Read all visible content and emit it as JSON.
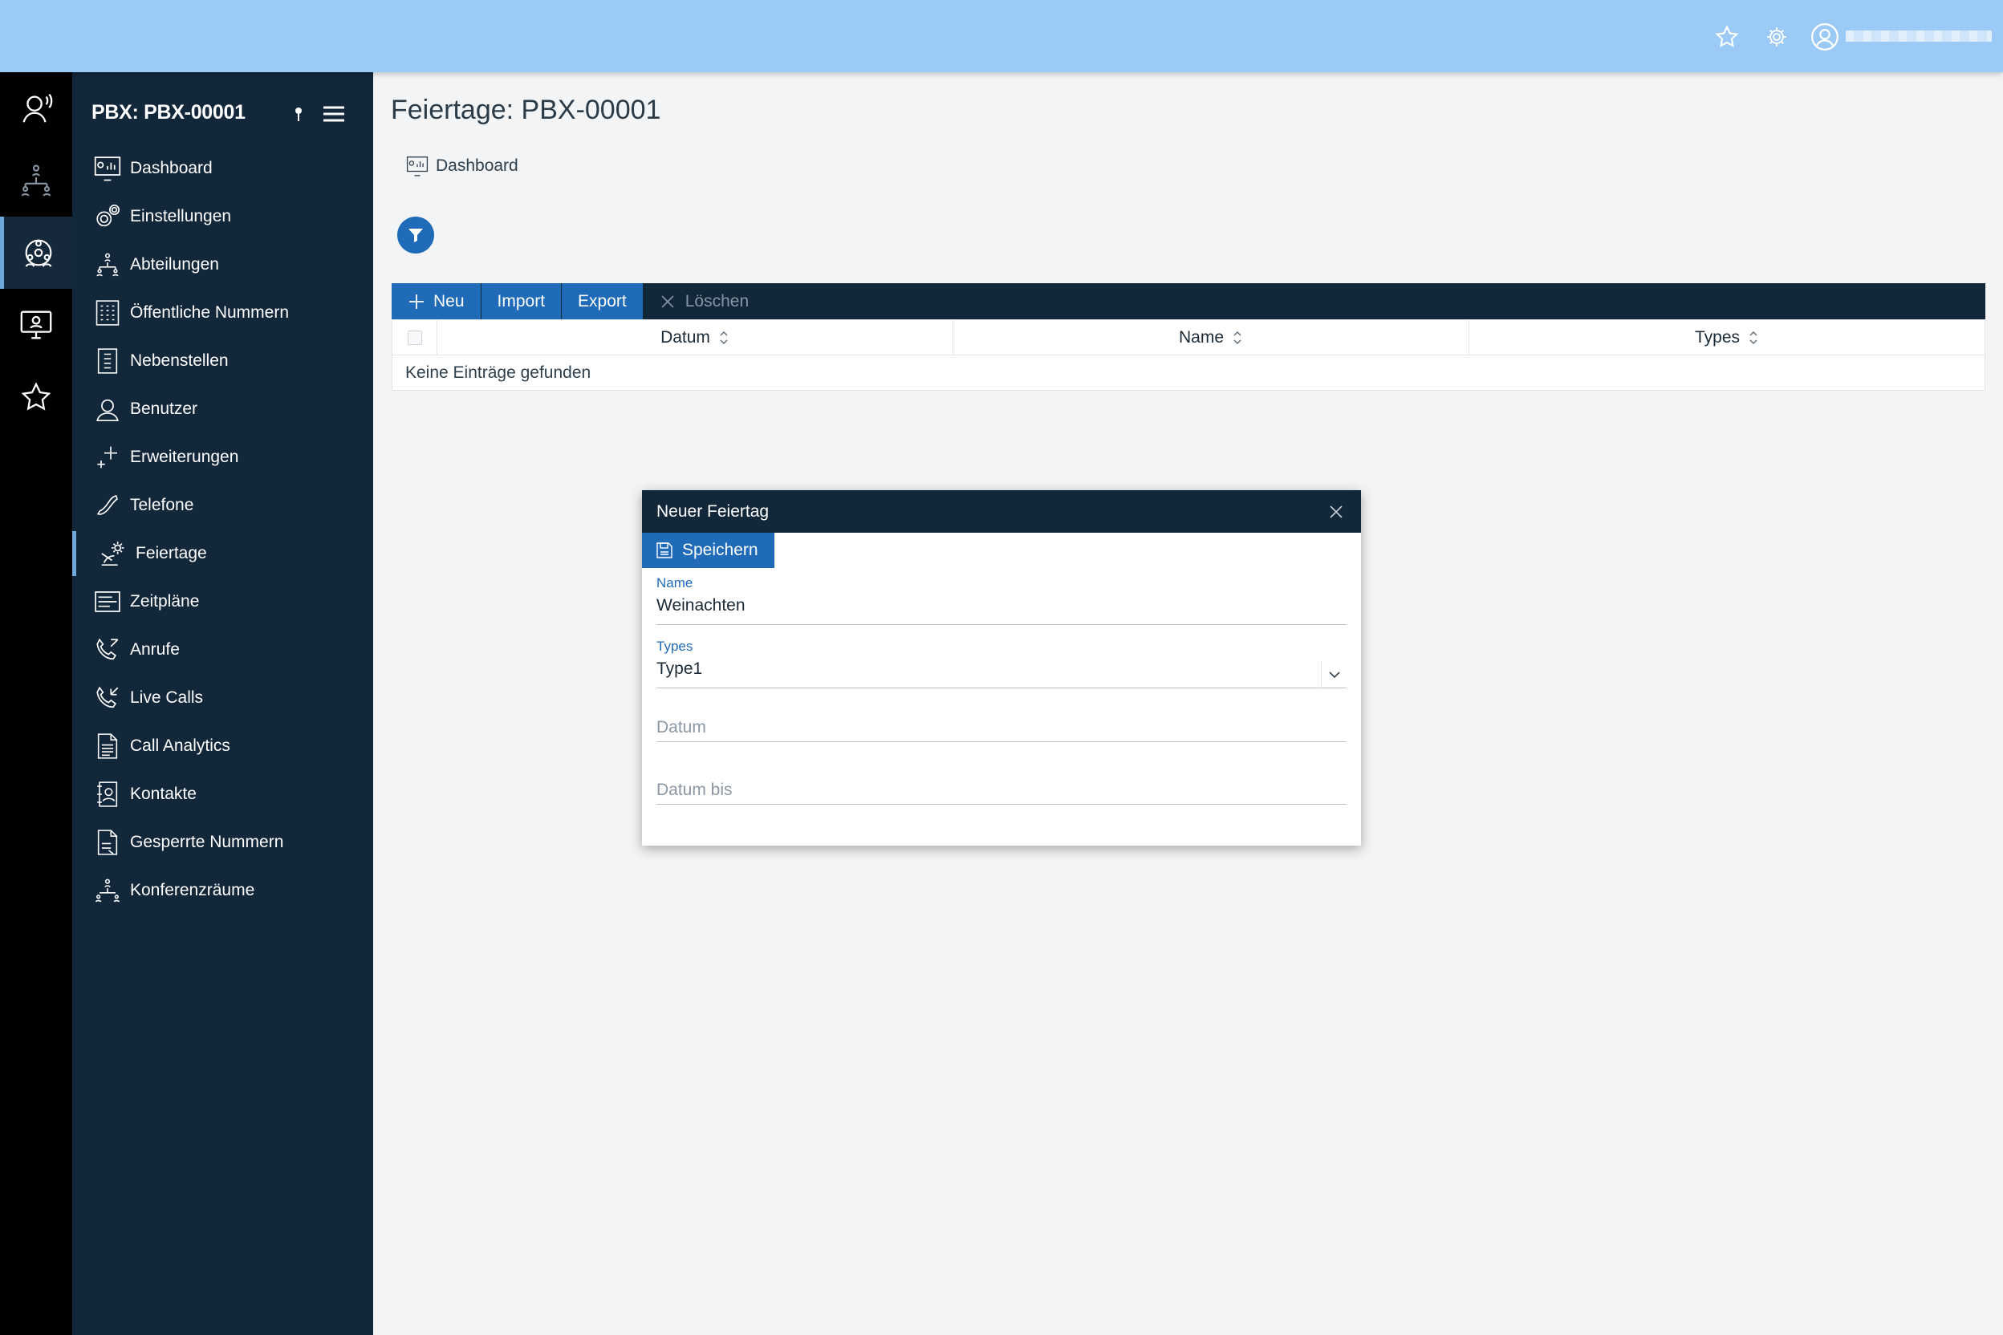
{
  "topbar": {
    "icons": [
      "star-icon",
      "gear-icon",
      "user-icon"
    ]
  },
  "rail": {
    "items": [
      {
        "icon": "headset-agent-icon"
      },
      {
        "icon": "org-structure-icon"
      },
      {
        "icon": "pbx-network-icon",
        "active": true
      },
      {
        "icon": "monitor-agent-icon"
      },
      {
        "icon": "star-icon"
      }
    ]
  },
  "sidebar": {
    "title": "PBX: PBX-00001",
    "items": [
      {
        "label": "Dashboard",
        "icon": "dashboard-icon"
      },
      {
        "label": "Einstellungen",
        "icon": "settings-gears-icon"
      },
      {
        "label": "Abteilungen",
        "icon": "departments-icon"
      },
      {
        "label": "Öffentliche Nummern",
        "icon": "public-numbers-icon"
      },
      {
        "label": "Nebenstellen",
        "icon": "extensions-icon"
      },
      {
        "label": "Benutzer",
        "icon": "user-icon"
      },
      {
        "label": "Erweiterungen",
        "icon": "plus-sparkle-icon"
      },
      {
        "label": "Telefone",
        "icon": "phone-icon"
      },
      {
        "label": "Feiertage",
        "icon": "holiday-icon",
        "active": true
      },
      {
        "label": "Zeitpläne",
        "icon": "schedule-icon"
      },
      {
        "label": "Anrufe",
        "icon": "calls-icon"
      },
      {
        "label": "Live Calls",
        "icon": "live-calls-icon"
      },
      {
        "label": "Call Analytics",
        "icon": "analytics-document-icon"
      },
      {
        "label": "Kontakte",
        "icon": "contacts-icon"
      },
      {
        "label": "Gesperrte Nummern",
        "icon": "blocked-numbers-icon"
      },
      {
        "label": "Konferenzräume",
        "icon": "conference-icon"
      }
    ]
  },
  "main": {
    "title": "Feiertage: PBX-00001",
    "breadcrumb": "Dashboard",
    "toolbar": {
      "new_label": "Neu",
      "import_label": "Import",
      "export_label": "Export",
      "delete_label": "Löschen"
    },
    "grid": {
      "columns": [
        "Datum",
        "Name",
        "Types"
      ],
      "empty_text": "Keine Einträge gefunden"
    }
  },
  "dialog": {
    "title": "Neuer Feiertag",
    "save_label": "Speichern",
    "name_label": "Name",
    "name_value": "Weinachten",
    "types_label": "Types",
    "types_value": "Type1",
    "datum_placeholder": "Datum",
    "datum_bis_placeholder": "Datum bis"
  },
  "colors": {
    "topbar": "#9ccaf7",
    "sidebar": "#12273a",
    "accent": "#1f6bb8",
    "rail": "#000000",
    "background": "#f2f4f5"
  }
}
